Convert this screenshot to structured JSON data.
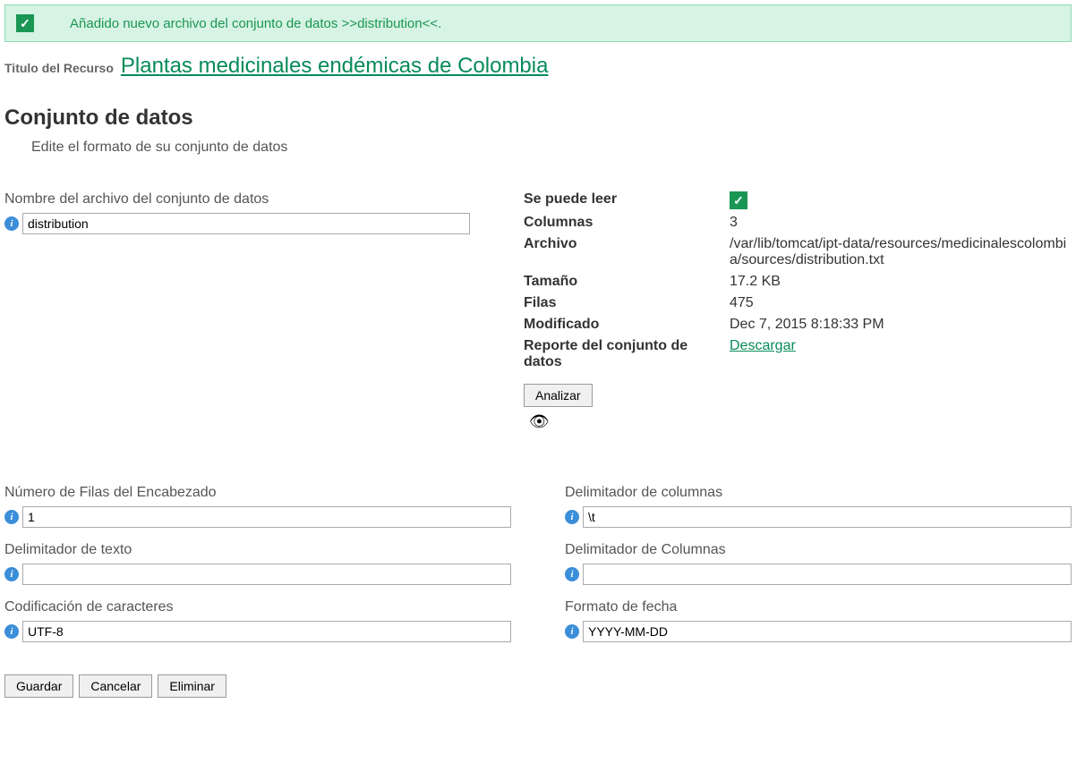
{
  "alert": {
    "message": "Añadido nuevo archivo del conjunto de datos >>distribution<<."
  },
  "resource": {
    "title_label": "Titulo del Recurso",
    "title_link": "Plantas medicinales endémicas de Colombia"
  },
  "section": {
    "heading": "Conjunto de datos",
    "subtitle": "Edite el formato de su conjunto de datos"
  },
  "filename": {
    "label": "Nombre del archivo del conjunto de datos",
    "value": "distribution"
  },
  "props": {
    "readable_label": "Se puede leer",
    "columns_label": "Columnas",
    "columns_value": "3",
    "file_label": "Archivo",
    "file_value": "/var/lib/tomcat/ipt-data/resources/medicinalescolombia/sources/distribution.txt",
    "size_label": "Tamaño",
    "size_value": "17.2 KB",
    "rows_label": "Filas",
    "rows_value": "475",
    "modified_label": "Modificado",
    "modified_value": "Dec 7, 2015 8:18:33 PM",
    "report_label": "Reporte del conjunto de datos",
    "download_link": "Descargar"
  },
  "analyze_button": "Analizar",
  "lower": {
    "header_rows_label": "Número de Filas del Encabezado",
    "header_rows_value": "1",
    "col_delim_label": "Delimitador de columnas",
    "col_delim_value": "\\t",
    "text_delim_label": "Delimitador de texto",
    "text_delim_value": "",
    "col_delim2_label": "Delimitador de Columnas",
    "col_delim2_value": "",
    "encoding_label": "Codificación de caracteres",
    "encoding_value": "UTF-8",
    "date_format_label": "Formato de fecha",
    "date_format_value": "YYYY-MM-DD"
  },
  "buttons": {
    "save": "Guardar",
    "cancel": "Cancelar",
    "delete": "Eliminar"
  }
}
